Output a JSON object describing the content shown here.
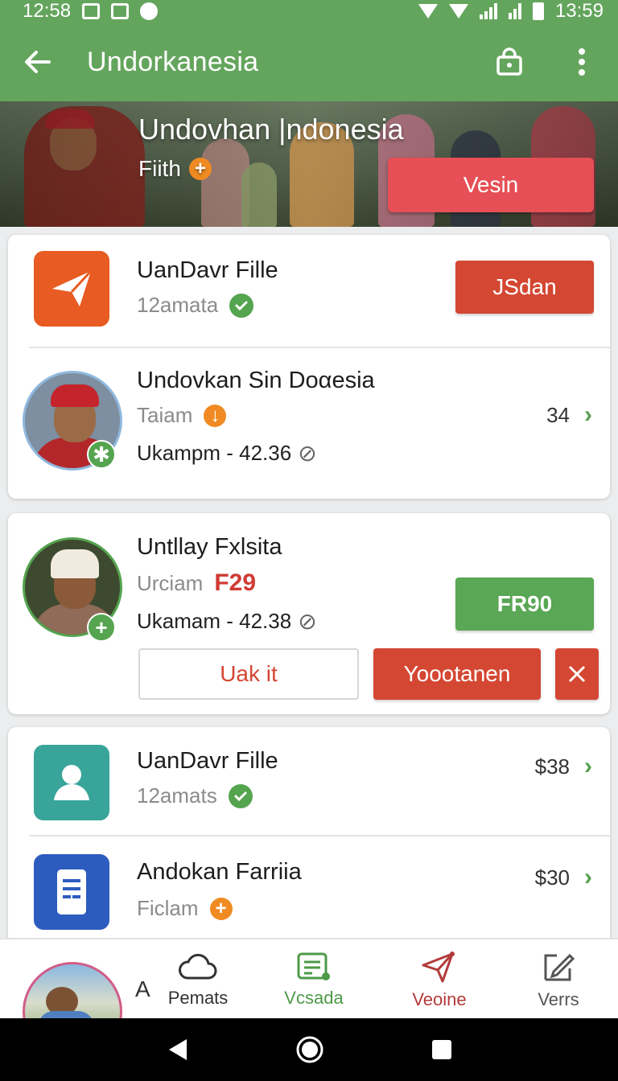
{
  "status_bar": {
    "time_left": "12:58",
    "time_right": "13:59"
  },
  "app_bar": {
    "title": "Undorkanesia"
  },
  "hero": {
    "title": "Undovhan |ndonesia",
    "subtitle": "Fiith",
    "cta_label": "Vesin"
  },
  "card1": {
    "row1": {
      "name": "UanDavr Fille",
      "meta": "12amata",
      "button": "JSdan",
      "icon": "paper-plane-icon",
      "icon_color": "#e85b22"
    },
    "row2": {
      "name": "Undovkan Sin Doαesia",
      "meta": "Taiam",
      "meta2": "Ukampm - 42.36",
      "count": "34"
    }
  },
  "card2": {
    "name": "Untllay Fxlsita",
    "meta": "Urciam",
    "code": "F29",
    "meta2": "Ukamam - 42.38",
    "green_button": "FR90",
    "outline_button": "Uak it",
    "red_button": "Yoootanen"
  },
  "card3": {
    "row1": {
      "name": "UanDavr Fille",
      "meta": "12amats",
      "price": "$38",
      "icon": "user-icon",
      "icon_color": "#38a49a"
    },
    "row2": {
      "name": "Andokan Farriia",
      "meta": "Ficlam",
      "price": "$30",
      "icon": "document-icon",
      "icon_color": "#2d5cbf"
    }
  },
  "bottom_nav": {
    "letter": "A",
    "items": [
      {
        "label": "Pemats",
        "icon": "cloud-icon",
        "color": "#333333"
      },
      {
        "label": "Vcsada",
        "icon": "receipt-icon",
        "color": "#4e9a48"
      },
      {
        "label": "Veoine",
        "icon": "send-icon",
        "color": "#b23a3a"
      },
      {
        "label": "Verrs",
        "icon": "edit-icon",
        "color": "#555555"
      }
    ]
  }
}
